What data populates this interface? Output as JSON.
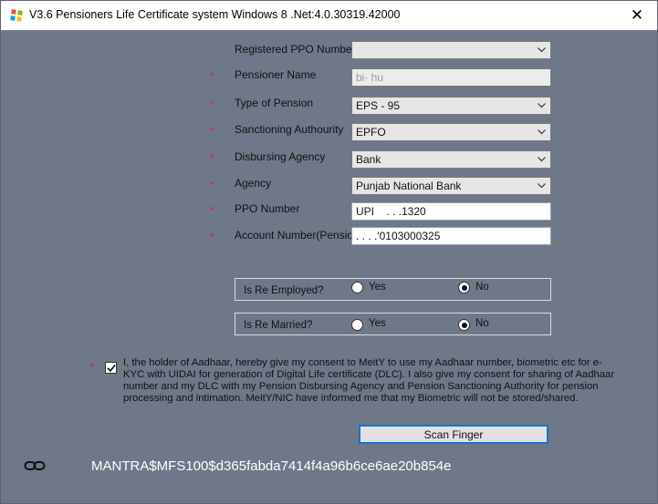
{
  "window": {
    "title": "V3.6 Pensioners Life Certificate system Windows 8 .Net:4.0.30319.42000",
    "close_glyph": "✕",
    "icon": "app-grid-icon"
  },
  "form": {
    "required_mark": "*",
    "fields": {
      "registered_ppo": {
        "label": "Registered PPO Number",
        "value": ""
      },
      "pensioner_name": {
        "label": "Pensioner Name",
        "value": "bi·  hu"
      },
      "type_of_pension": {
        "label": "Type of Pension",
        "value": "EPS - 95"
      },
      "sanctioning_authority": {
        "label": "Sanctioning Authourity",
        "value": "EPFO"
      },
      "disbursing_agency": {
        "label": "Disbursing Agency",
        "value": "Bank"
      },
      "agency": {
        "label": "Agency",
        "value": "Punjab National Bank"
      },
      "ppo_number": {
        "label": "PPO Number",
        "value": "UPI     .  . .1320"
      },
      "account_number": {
        "label": "Account Number(Pension)",
        "value": ". . . .'0103000325"
      }
    }
  },
  "re_employed": {
    "label": "Is Re Employed?",
    "yes_label": "Yes",
    "no_label": "No",
    "selected": "No"
  },
  "re_married": {
    "label": "Is Re Married?",
    "yes_label": "Yes",
    "no_label": "No",
    "selected": "No"
  },
  "consent": {
    "checked": true,
    "text": "I, the holder of Aadhaar, hereby give my consent to MeitY to use my Aadhaar number, biometric etc for e-KYC with UIDAI for generation of Digital Life certificate (DLC). I also give my consent for sharing of Aadhaar number and my DLC with my Pension Disbursing Agency and Pension Sanctioning Authority for pension processing and intimation. MeitY/NIC have informed me that my Biometric will not be stored/shared."
  },
  "scan_button_label": "Scan Finger",
  "device": {
    "icon": "link-icon",
    "id": "MANTRA$MFS100$d365fabda7414f4a96b6ce6ae20b854e"
  },
  "colors": {
    "background": "#6e7889",
    "required": "#e2262e",
    "focus_border": "#1a6fd6",
    "device_text": "#ffffff"
  }
}
